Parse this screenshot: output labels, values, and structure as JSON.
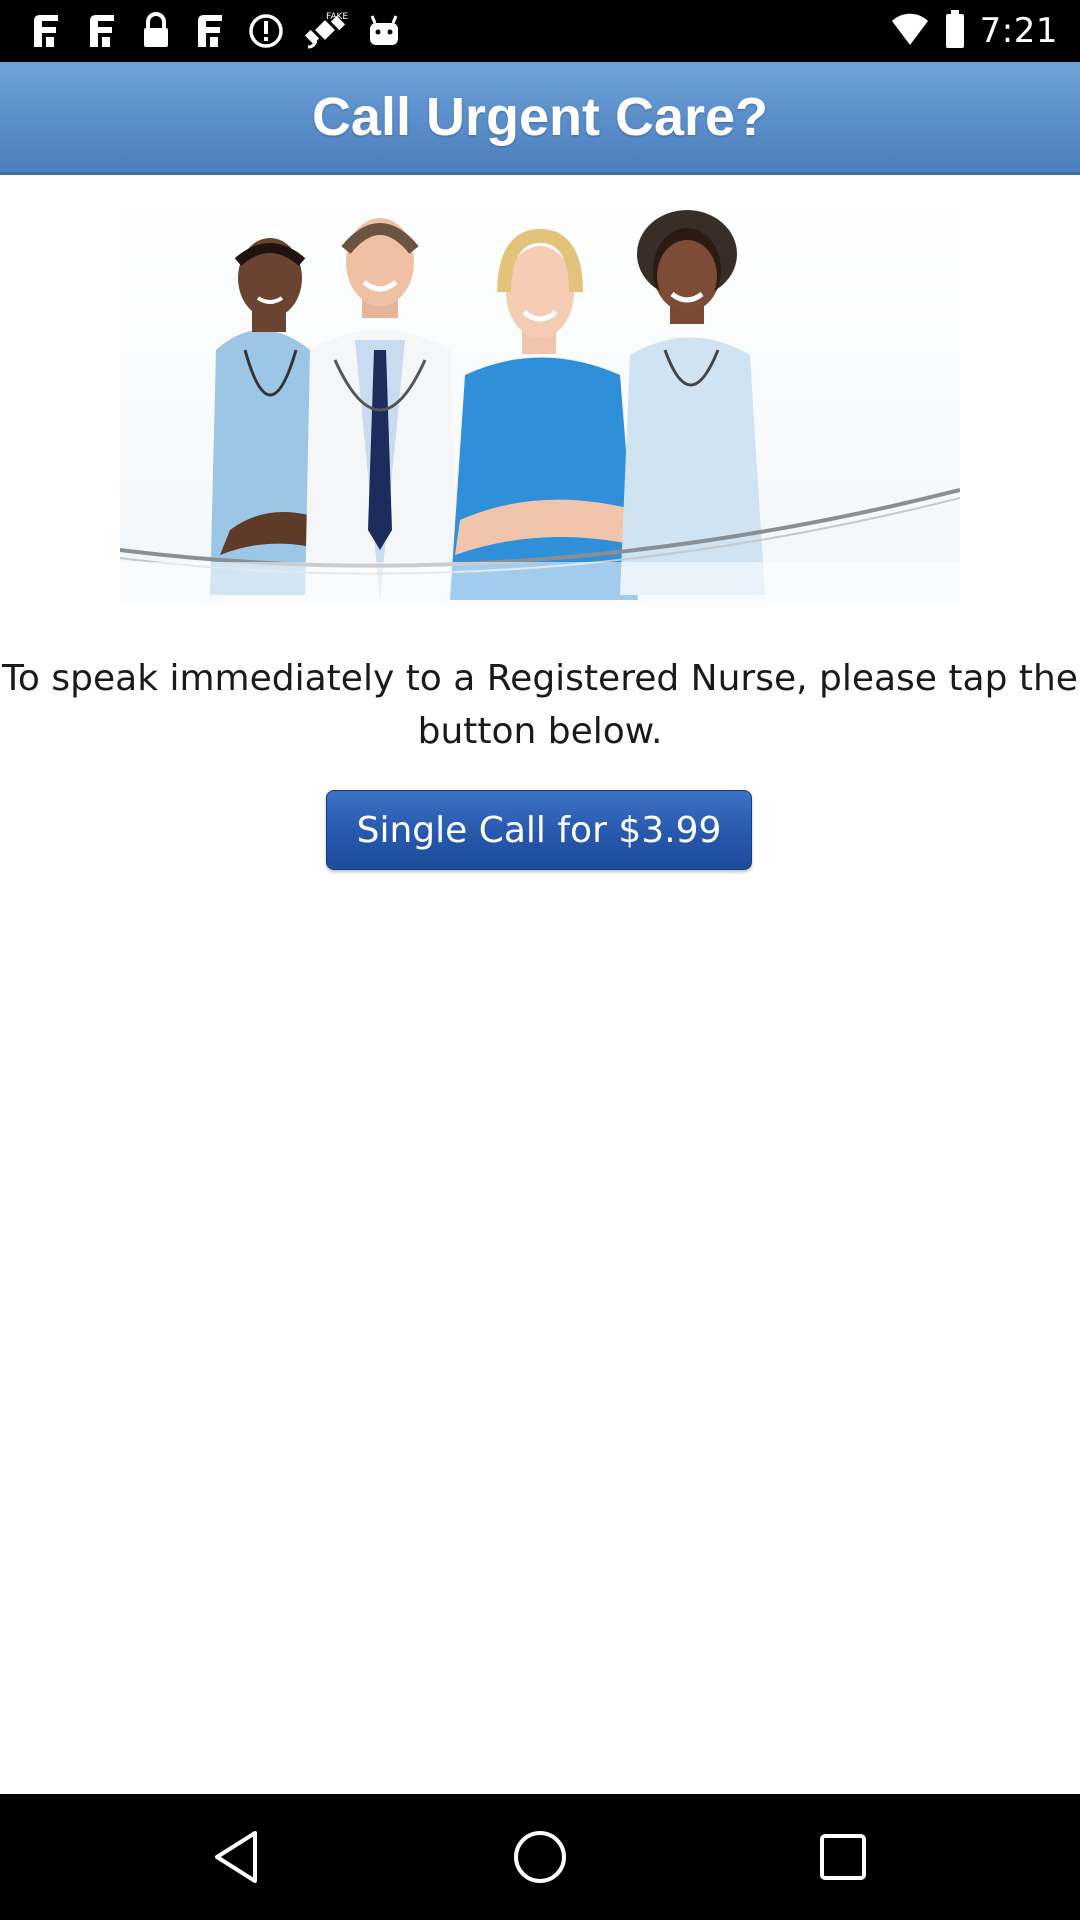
{
  "status_bar": {
    "time": "7:21",
    "icons": [
      "app-notification-icon",
      "app-notification-icon",
      "lock-icon",
      "app-notification-icon",
      "alert-circle-icon",
      "fake-gps-icon",
      "android-icon"
    ],
    "right_icons": [
      "wifi-icon",
      "battery-icon"
    ]
  },
  "header": {
    "title": "Call Urgent Care?",
    "color_top": "#6fa3d8",
    "color_bottom": "#4d7fbd"
  },
  "main": {
    "hero_image": "doctors-and-nurses-team-photo",
    "message": "To speak immediately to a Registered Nurse, please tap the button below.",
    "call_button_label": "Single Call for $3.99",
    "button_color": "#2658ad"
  },
  "nav_bar": {
    "buttons": [
      "back-icon",
      "home-icon",
      "recents-icon"
    ]
  }
}
